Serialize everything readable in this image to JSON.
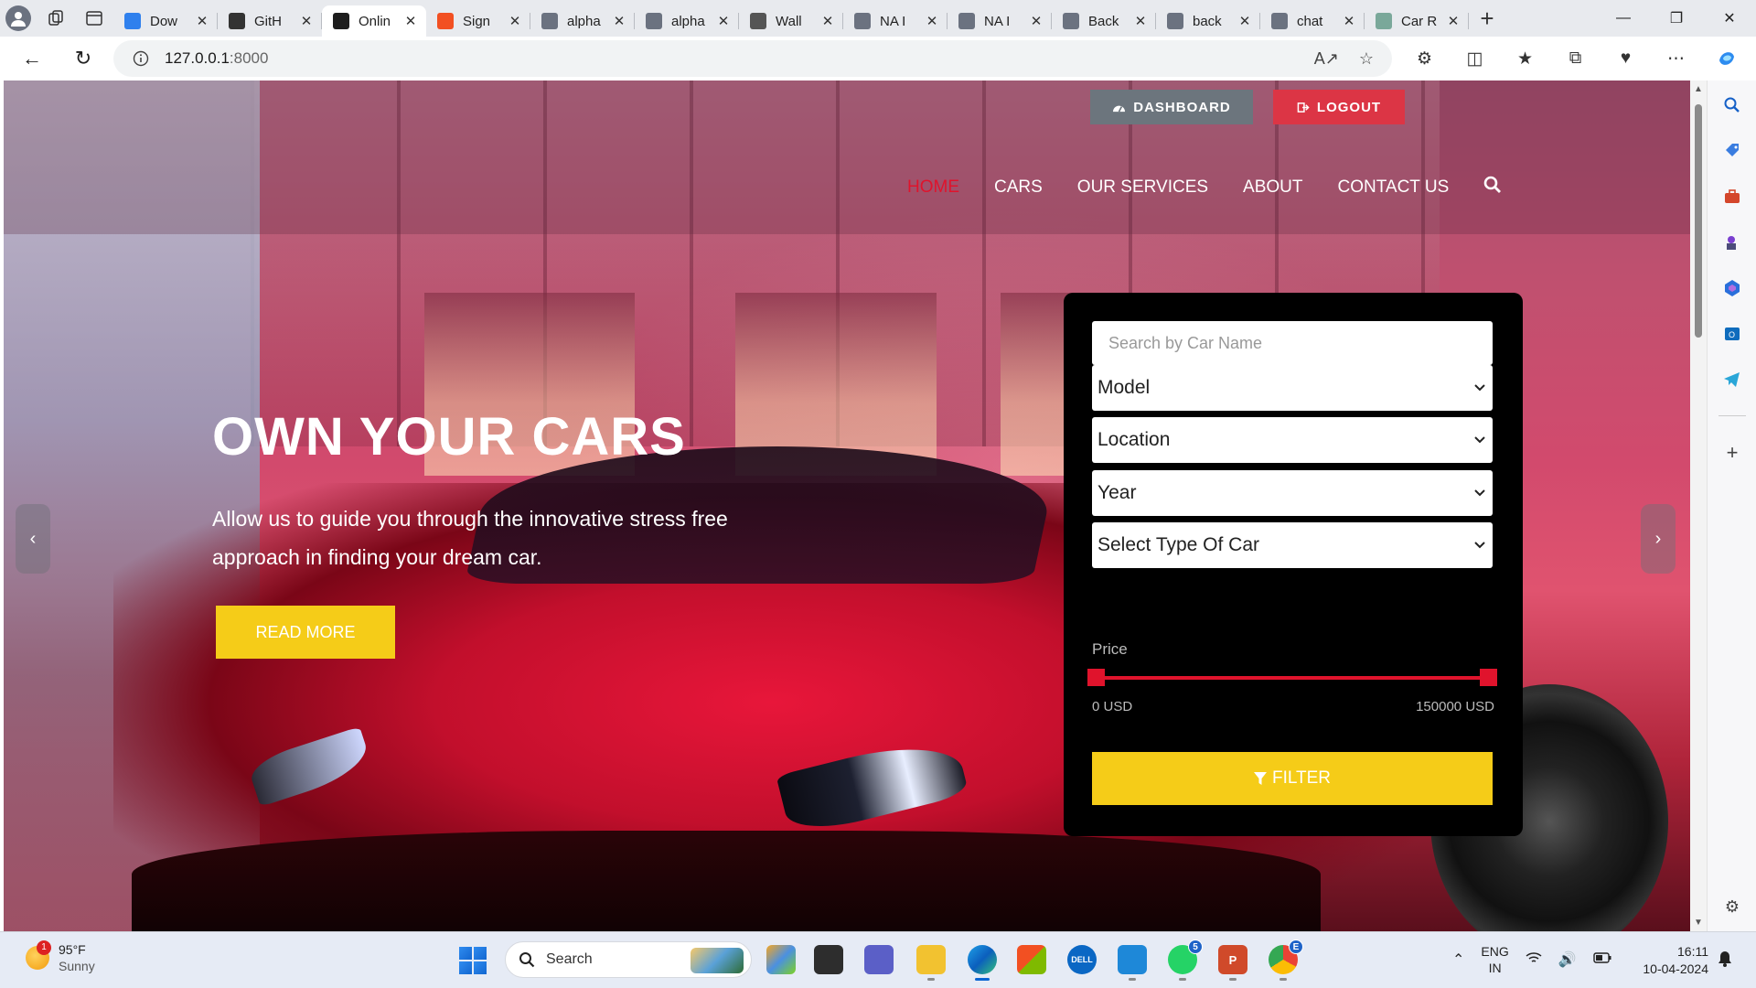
{
  "browser": {
    "tabs": [
      {
        "title": "Dow",
        "favicon": "vscode-icon",
        "color": "#2f80ed"
      },
      {
        "title": "GitH",
        "favicon": "github-icon",
        "color": "#333333"
      },
      {
        "title": "Onlin",
        "favicon": "car-site-icon",
        "color": "#1d1d1d",
        "active": true
      },
      {
        "title": "Sign",
        "favicon": "microsoft-icon",
        "color": "#f25022"
      },
      {
        "title": "alpha",
        "favicon": "search-icon",
        "color": "#6b7280"
      },
      {
        "title": "alpha",
        "favicon": "search-icon",
        "color": "#6b7280"
      },
      {
        "title": "Wall",
        "favicon": "image-icon",
        "color": "#555555"
      },
      {
        "title": "NA I",
        "favicon": "search-icon",
        "color": "#6b7280"
      },
      {
        "title": "NA I",
        "favicon": "search-icon",
        "color": "#6b7280"
      },
      {
        "title": "Back",
        "favicon": "search-icon",
        "color": "#6b7280"
      },
      {
        "title": "back",
        "favicon": "search-icon",
        "color": "#6b7280"
      },
      {
        "title": "chat",
        "favicon": "search-icon",
        "color": "#6b7280"
      },
      {
        "title": "Car R",
        "favicon": "chatgpt-icon",
        "color": "#7aa89a"
      }
    ],
    "url_host": "127.0.0.1",
    "url_port": ":8000"
  },
  "site": {
    "top_buttons": {
      "dashboard": "DASHBOARD",
      "logout": "LOGOUT"
    },
    "nav": [
      {
        "label": "HOME",
        "active": true
      },
      {
        "label": "CARS"
      },
      {
        "label": "OUR SERVICES"
      },
      {
        "label": "ABOUT"
      },
      {
        "label": "CONTACT US"
      }
    ],
    "hero": {
      "title": "OWN YOUR CARS",
      "subtitle": "Allow us to guide you through the innovative stress free approach in finding your dream car.",
      "cta": "READ MORE"
    },
    "search_panel": {
      "search_placeholder": "Search by Car Name",
      "model": "Model",
      "location": "Location",
      "year": "Year",
      "car_type": "Select Type Of Car",
      "price_label": "Price",
      "price_min": "0 USD",
      "price_max": "150000 USD",
      "filter_label": "FILTER"
    },
    "colors": {
      "accent_red": "#e0132c",
      "accent_yellow": "#f5cc18",
      "dashboard_gray": "#6c757d",
      "logout_red": "#dc3545"
    }
  },
  "taskbar": {
    "weather_temp": "95°F",
    "weather_desc": "Sunny",
    "weather_badge": "1",
    "search_label": "Search",
    "whatsapp_badge": "5",
    "chrome_badge": "E",
    "lang_top": "ENG",
    "lang_bottom": "IN",
    "time": "16:11",
    "date": "10-04-2024"
  }
}
